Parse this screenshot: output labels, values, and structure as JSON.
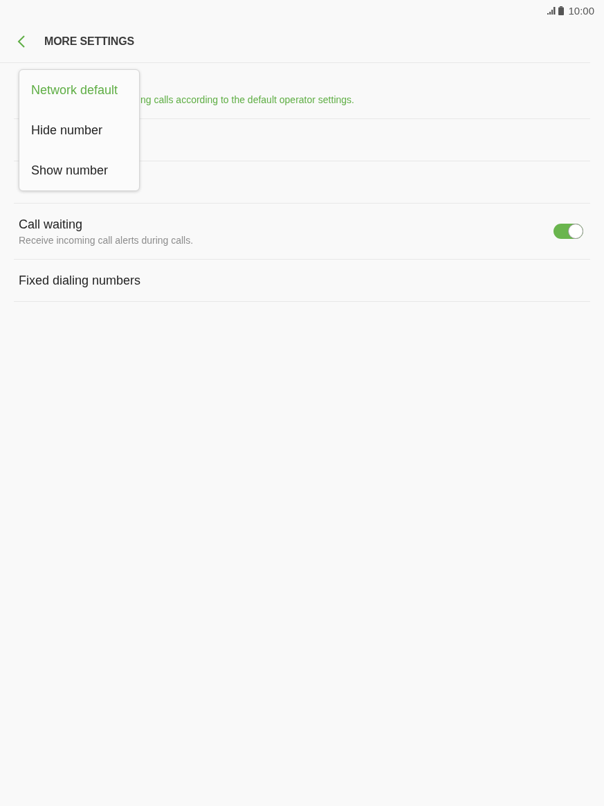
{
  "status_bar": {
    "time": "10:00"
  },
  "header": {
    "title": "MORE SETTINGS"
  },
  "settings": [
    {
      "kind": "covered",
      "subtitle": "ng calls according to the default operator settings."
    },
    {
      "kind": "covered"
    },
    {
      "kind": "covered"
    },
    {
      "kind": "switch",
      "title": "Call waiting",
      "subtitle": "Receive incoming call alerts during calls.",
      "on": true
    },
    {
      "kind": "plain",
      "title": "Fixed dialing numbers"
    }
  ],
  "menu": {
    "items": [
      {
        "label": "Network default",
        "selected": true
      },
      {
        "label": "Hide number",
        "selected": false
      },
      {
        "label": "Show number",
        "selected": false
      }
    ]
  }
}
